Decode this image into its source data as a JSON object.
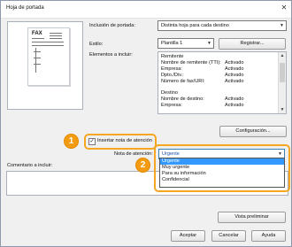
{
  "window": {
    "title": "Hoja de portada"
  },
  "preview": {
    "fax_label": "FAX"
  },
  "form": {
    "inclusion_label": "Inclusión de portada:",
    "inclusion_value": "Distinta hoja para cada destino",
    "style_label": "Estilo:",
    "style_value": "Plantilla 1",
    "register_button": "Registrar...",
    "elements_label": "Elementos a incluir:",
    "config_button": "Configuración...",
    "attention_checkbox_label": "Insertar nota de atención",
    "attention_checked": true,
    "attention_note_label": "Nota de atención:",
    "attention_note_value": "Urgente",
    "comment_label": "Comentario a incluir:",
    "preview_button": "Vista preliminar",
    "accept_button": "Aceptar",
    "cancel_button": "Cancelar",
    "help_button": "Ayuda"
  },
  "elements": [
    {
      "name": "Remitente",
      "value": ""
    },
    {
      "name": "Nombre de remitente (TTI):",
      "value": "Activado"
    },
    {
      "name": "Empresa:",
      "value": "Activado"
    },
    {
      "name": "Dpto./Div.:",
      "value": "Activado"
    },
    {
      "name": "Número de fax/URI:",
      "value": "Activado"
    },
    {
      "name": "",
      "value": ""
    },
    {
      "name": "Destino",
      "value": ""
    },
    {
      "name": "Nombre de destino:",
      "value": "Activado"
    },
    {
      "name": "Empresa:",
      "value": "Activado"
    }
  ],
  "dropdown_options": [
    "Urgente",
    "Muy urgente",
    "Para su información",
    "Confidencial"
  ],
  "callouts": {
    "one": "1",
    "two": "2"
  },
  "colors": {
    "callout": "#f5a623",
    "selection": "#3399ff"
  }
}
